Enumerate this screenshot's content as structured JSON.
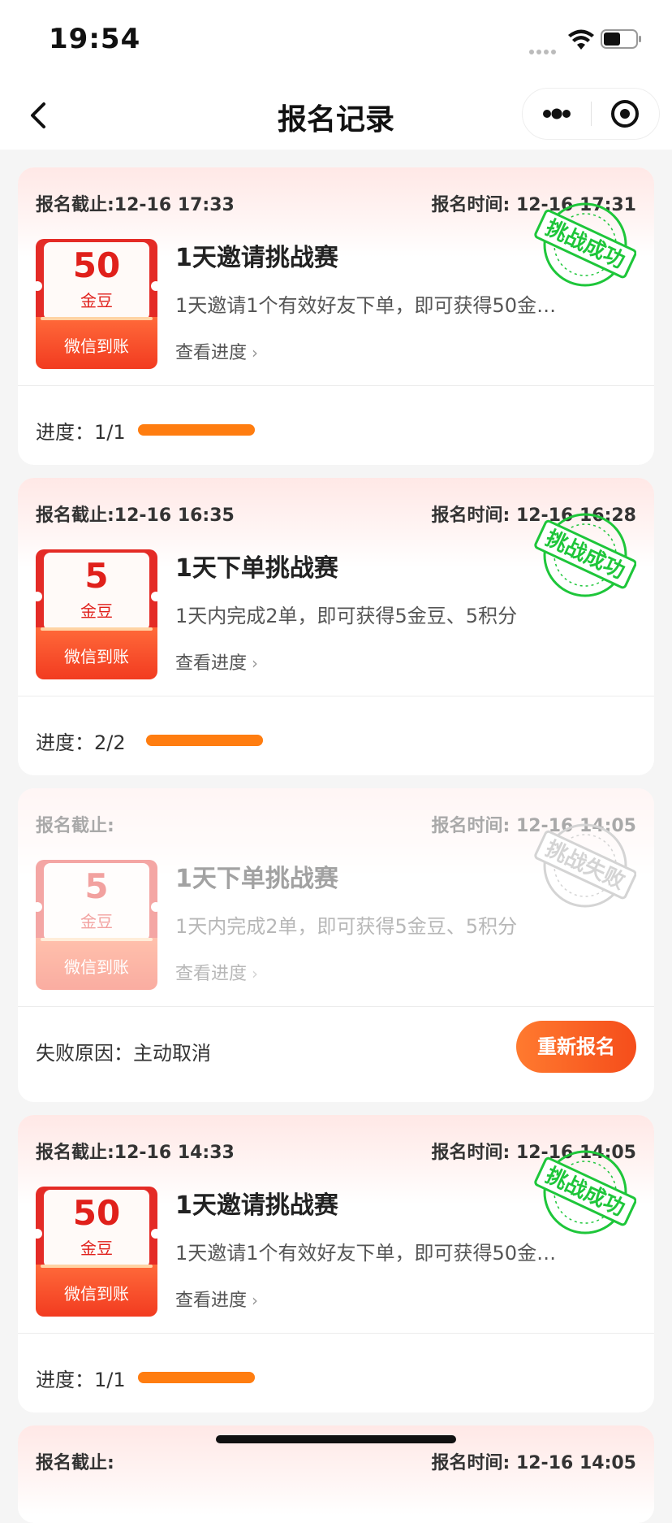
{
  "status_bar": {
    "time": "19:54"
  },
  "nav": {
    "title": "报名记录"
  },
  "records": [
    {
      "deadline": "报名截止:12-16 17:33",
      "signup_time": "报名时间: 12-16 17:31",
      "coupon_amount": "50",
      "coupon_unit": "金豆",
      "coupon_channel": "微信到账",
      "title": "1天邀请挑战赛",
      "desc": "1天邀请1个有效好友下单，即可获得50金…",
      "link": "查看进度",
      "stamp": "挑战成功",
      "progress_label": "进度：1/1",
      "progress": 1.0
    },
    {
      "deadline": "报名截止:12-16 16:35",
      "signup_time": "报名时间: 12-16 16:28",
      "coupon_amount": "5",
      "coupon_unit": "金豆",
      "coupon_channel": "微信到账",
      "title": "1天下单挑战赛",
      "desc": "1天内完成2单，即可获得5金豆、5积分",
      "link": "查看进度",
      "stamp": "挑战成功",
      "progress_label": "进度：2/2",
      "progress": 1.0
    },
    {
      "deadline": "报名截止:",
      "signup_time": "报名时间: 12-16 14:05",
      "coupon_amount": "5",
      "coupon_unit": "金豆",
      "coupon_channel": "微信到账",
      "title": "1天下单挑战赛",
      "desc": "1天内完成2单，即可获得5金豆、5积分",
      "link": "查看进度",
      "stamp": "挑战失败",
      "fail_reason": "失败原因：主动取消",
      "retry_button": "重新报名"
    },
    {
      "deadline": "报名截止:12-16 14:33",
      "signup_time": "报名时间: 12-16 14:05",
      "coupon_amount": "50",
      "coupon_unit": "金豆",
      "coupon_channel": "微信到账",
      "title": "1天邀请挑战赛",
      "desc": "1天邀请1个有效好友下单，即可获得50金…",
      "link": "查看进度",
      "stamp": "挑战成功",
      "progress_label": "进度：1/1",
      "progress": 1.0
    },
    {
      "deadline": "报名截止:",
      "signup_time": "报名时间: 12-16 14:05"
    }
  ],
  "colors": {
    "success_stamp": "#1ec63a",
    "fail_stamp": "#c8c8c8",
    "progress": "#ff7d10",
    "accent": "#f54d1b"
  }
}
